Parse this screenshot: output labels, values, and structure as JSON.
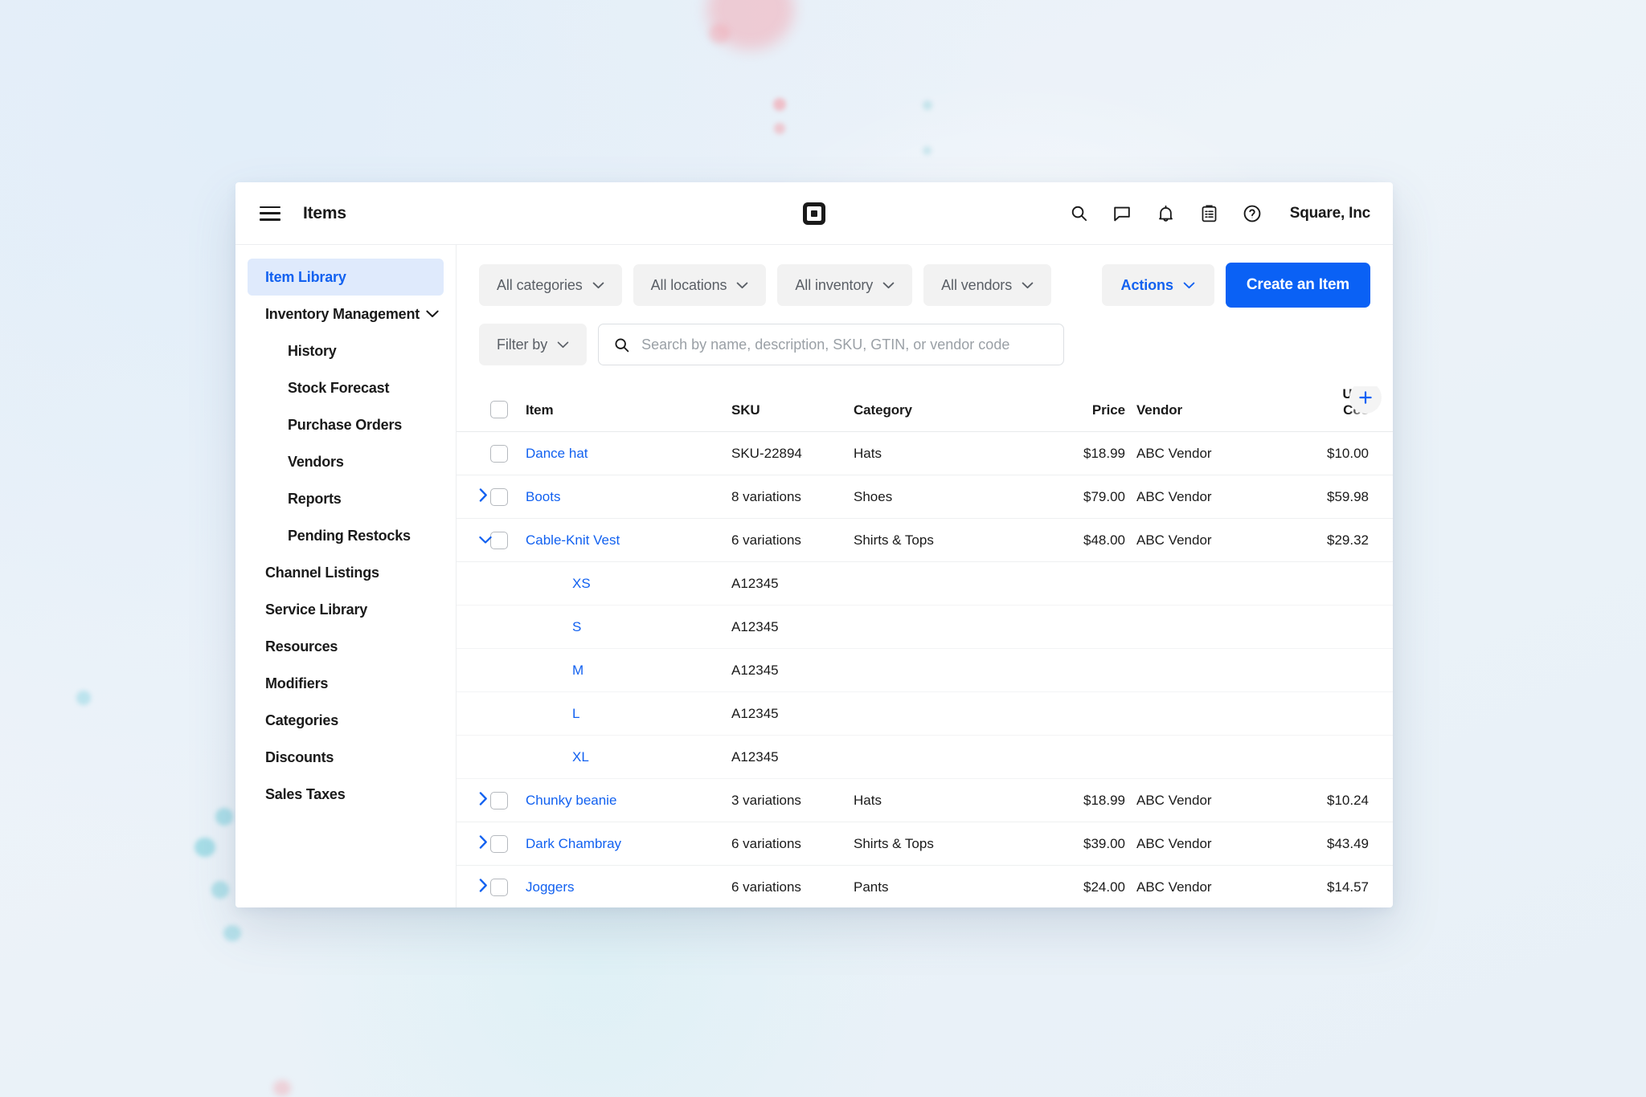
{
  "topbar": {
    "menu_icon": "hamburger-menu-icon",
    "title": "Items",
    "logo": "square-logo",
    "icons": [
      {
        "name": "search-icon",
        "label": "Search"
      },
      {
        "name": "messages-icon",
        "label": "Messages"
      },
      {
        "name": "notifications-bell-icon",
        "label": "Notifications"
      },
      {
        "name": "clipboard-icon",
        "label": "Tasks"
      },
      {
        "name": "help-icon",
        "label": "Help"
      }
    ],
    "account": "Square, Inc"
  },
  "sidebar": {
    "items": [
      {
        "label": "Item Library",
        "active": true,
        "sub": false,
        "expandable": false
      },
      {
        "label": "Inventory Management",
        "active": false,
        "sub": false,
        "expandable": true
      },
      {
        "label": "History",
        "active": false,
        "sub": true,
        "expandable": false
      },
      {
        "label": "Stock Forecast",
        "active": false,
        "sub": true,
        "expandable": false
      },
      {
        "label": "Purchase Orders",
        "active": false,
        "sub": true,
        "expandable": false
      },
      {
        "label": "Vendors",
        "active": false,
        "sub": true,
        "expandable": false
      },
      {
        "label": "Reports",
        "active": false,
        "sub": true,
        "expandable": false
      },
      {
        "label": "Pending Restocks",
        "active": false,
        "sub": true,
        "expandable": false
      },
      {
        "label": "Channel Listings",
        "active": false,
        "sub": false,
        "expandable": false
      },
      {
        "label": "Service Library",
        "active": false,
        "sub": false,
        "expandable": false
      },
      {
        "label": "Resources",
        "active": false,
        "sub": false,
        "expandable": false
      },
      {
        "label": "Modifiers",
        "active": false,
        "sub": false,
        "expandable": false
      },
      {
        "label": "Categories",
        "active": false,
        "sub": false,
        "expandable": false
      },
      {
        "label": "Discounts",
        "active": false,
        "sub": false,
        "expandable": false
      },
      {
        "label": "Sales Taxes",
        "active": false,
        "sub": false,
        "expandable": false
      }
    ]
  },
  "toolbar": {
    "filters": [
      {
        "label": "All categories"
      },
      {
        "label": "All locations"
      },
      {
        "label": "All inventory"
      },
      {
        "label": "All vendors"
      }
    ],
    "actions_label": "Actions",
    "create_label": "Create an Item",
    "filter_by_label": "Filter by",
    "search_placeholder": "Search by name, description, SKU, GTIN, or vendor code",
    "search_value": ""
  },
  "table": {
    "headers": {
      "item": "Item",
      "sku": "SKU",
      "category": "Category",
      "price": "Price",
      "vendor": "Vendor",
      "unit_cost": "Unit Cos",
      "add_column": "+"
    },
    "rows": [
      {
        "type": "item",
        "expandable": false,
        "expanded": false,
        "name": "Dance hat",
        "sku": "SKU-22894",
        "category": "Hats",
        "price": "$18.99",
        "vendor": "ABC Vendor",
        "unit_cost": "$10.00"
      },
      {
        "type": "item",
        "expandable": true,
        "expanded": false,
        "name": "Boots",
        "sku": "8 variations",
        "category": "Shoes",
        "price": "$79.00",
        "vendor": "ABC Vendor",
        "unit_cost": "$59.98"
      },
      {
        "type": "item",
        "expandable": true,
        "expanded": true,
        "name": "Cable-Knit Vest",
        "sku": "6 variations",
        "category": "Shirts & Tops",
        "price": "$48.00",
        "vendor": "ABC Vendor",
        "unit_cost": "$29.32"
      },
      {
        "type": "variation",
        "name": "XS",
        "sku": "A12345",
        "category": "",
        "price": "",
        "vendor": "",
        "unit_cost": ""
      },
      {
        "type": "variation",
        "name": "S",
        "sku": "A12345",
        "category": "",
        "price": "",
        "vendor": "",
        "unit_cost": ""
      },
      {
        "type": "variation",
        "name": "M",
        "sku": "A12345",
        "category": "",
        "price": "",
        "vendor": "",
        "unit_cost": ""
      },
      {
        "type": "variation",
        "name": "L",
        "sku": "A12345",
        "category": "",
        "price": "",
        "vendor": "",
        "unit_cost": ""
      },
      {
        "type": "variation",
        "name": "XL",
        "sku": "A12345",
        "category": "",
        "price": "",
        "vendor": "",
        "unit_cost": ""
      },
      {
        "type": "item",
        "expandable": true,
        "expanded": false,
        "name": "Chunky beanie",
        "sku": "3 variations",
        "category": "Hats",
        "price": "$18.99",
        "vendor": "ABC Vendor",
        "unit_cost": "$10.24"
      },
      {
        "type": "item",
        "expandable": true,
        "expanded": false,
        "name": "Dark Chambray",
        "sku": "6 variations",
        "category": "Shirts & Tops",
        "price": "$39.00",
        "vendor": "ABC Vendor",
        "unit_cost": "$43.49"
      },
      {
        "type": "item",
        "expandable": true,
        "expanded": false,
        "name": "Joggers",
        "sku": "6 variations",
        "category": "Pants",
        "price": "$24.00",
        "vendor": "ABC Vendor",
        "unit_cost": "$14.57"
      }
    ]
  },
  "colors": {
    "accent_blue": "#0a61f5",
    "link_blue": "#1261f0",
    "active_nav_bg": "#dfeafc",
    "pill_bg": "#f2f2f2",
    "page_bg": "#e8f0f7"
  }
}
